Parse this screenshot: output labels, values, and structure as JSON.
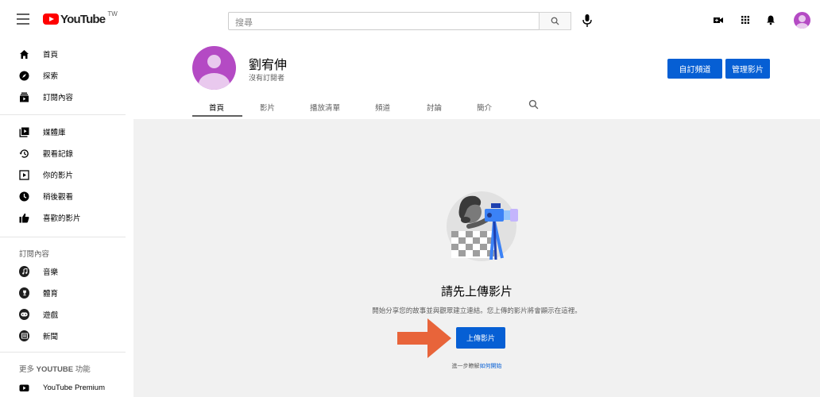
{
  "header": {
    "logo_text": "YouTube",
    "region": "TW",
    "search_placeholder": "搜尋"
  },
  "sidebar": {
    "primary": [
      {
        "label": "首頁",
        "icon": "home-icon"
      },
      {
        "label": "探索",
        "icon": "explore-icon"
      },
      {
        "label": "訂閱內容",
        "icon": "subscriptions-icon"
      }
    ],
    "library": [
      {
        "label": "媒體庫",
        "icon": "library-icon"
      },
      {
        "label": "觀看記錄",
        "icon": "history-icon"
      },
      {
        "label": "你的影片",
        "icon": "your-videos-icon"
      },
      {
        "label": "稍後觀看",
        "icon": "watch-later-icon"
      },
      {
        "label": "喜歡的影片",
        "icon": "liked-icon"
      }
    ],
    "subs_heading": "訂閱內容",
    "subscriptions": [
      {
        "label": "音樂",
        "icon": "music-icon"
      },
      {
        "label": "體育",
        "icon": "sports-icon"
      },
      {
        "label": "遊戲",
        "icon": "gaming-icon"
      },
      {
        "label": "新聞",
        "icon": "news-icon"
      }
    ],
    "more_prefix": "更多 ",
    "more_brand": "YOUTUBE",
    "more_suffix": " 功能",
    "premium": {
      "label": "YouTube Premium",
      "icon": "premium-icon"
    }
  },
  "channel": {
    "name": "劉宥伸",
    "subscribers": "沒有訂閱者",
    "customize_button": "自訂頻道",
    "manage_button": "管理影片",
    "tabs": [
      "首頁",
      "影片",
      "播放清單",
      "頻道",
      "討論",
      "簡介"
    ]
  },
  "empty_state": {
    "title": "請先上傳影片",
    "description": "開始分享您的故事並與觀眾建立連結。您上傳的影片將會顯示在這裡。",
    "upload_button": "上傳影片",
    "learn_prefix": "進一步瞭解",
    "learn_link": "如何開始"
  },
  "colors": {
    "accent": "#065fd4",
    "brand": "#ff0000",
    "avatar": "#b44ac4",
    "arrow": "#e8643a"
  }
}
